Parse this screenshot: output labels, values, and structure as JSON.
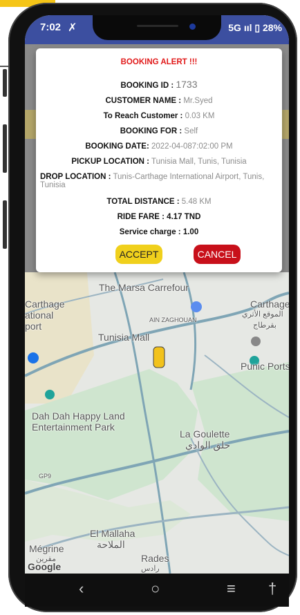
{
  "status": {
    "time": "7:02",
    "right": "5G ııl ▯ 28%"
  },
  "dialog": {
    "title": "BOOKING ALERT !!!",
    "booking_id_label": "BOOKING ID :",
    "booking_id_value": "1733",
    "customer_label": "CUSTOMER NAME :",
    "customer_value": "Mr.Syed",
    "reach_label": "To Reach Customer :",
    "reach_value": "0.03 KM",
    "booking_for_label": "BOOKING FOR :",
    "booking_for_value": "Self",
    "date_label": "BOOKING DATE:",
    "date_value": "2022-04-087:02:00 PM",
    "pickup_label": "PICKUP LOCATION :",
    "pickup_value": "Tunisia Mall, Tunis, Tunisia",
    "drop_label": "DROP LOCATION :",
    "drop_value": "Tunis-Carthage International Airport, Tunis, Tunisia",
    "distance_label": "TOTAL DISTANCE :",
    "distance_value": "5.48 KM",
    "fare_label": "RIDE FARE :",
    "fare_value": "4.17 TND",
    "service_label": "Service charge :",
    "service_value": "1.00",
    "accept": "ACCEPT",
    "cancel": "CANCEL"
  },
  "map": {
    "marsa_carrefour": "The Marsa Carrefour",
    "carthage_left_1": "Carthage",
    "carthage_left_2": "ational",
    "carthage_left_3": "port",
    "carthage_right": "Carthage",
    "carthage_right_ar1": "الموقع الأثري",
    "carthage_right_ar2": "بقرطاج",
    "ain_zaghouan": "AIN ZAGHOUAN",
    "tunisia_mall": "Tunisia Mall",
    "punic_ports": "Punic Ports",
    "dah_dah_1": "Dah Dah Happy Land",
    "dah_dah_2": "Entertainment Park",
    "la_goulette": "La Goulette",
    "la_goulette_ar": "حلق الوادي",
    "el_mallaha": "El Mallaha",
    "el_mallaha_ar": "الملاحة",
    "megrine": "Mégrine",
    "megrine_ar": "مقرين",
    "rades": "Rades",
    "rades_ar": "رادس",
    "google": "Google",
    "road_label": "GP9"
  },
  "nav": {
    "back": "‹",
    "home": "○",
    "recents": "≡",
    "accessibility": "†"
  },
  "colors": {
    "status_bar": "#3c4fa0",
    "alert_red": "#e11a1a",
    "accept_yellow": "#f0d01c",
    "cancel_red": "#c8101a"
  }
}
